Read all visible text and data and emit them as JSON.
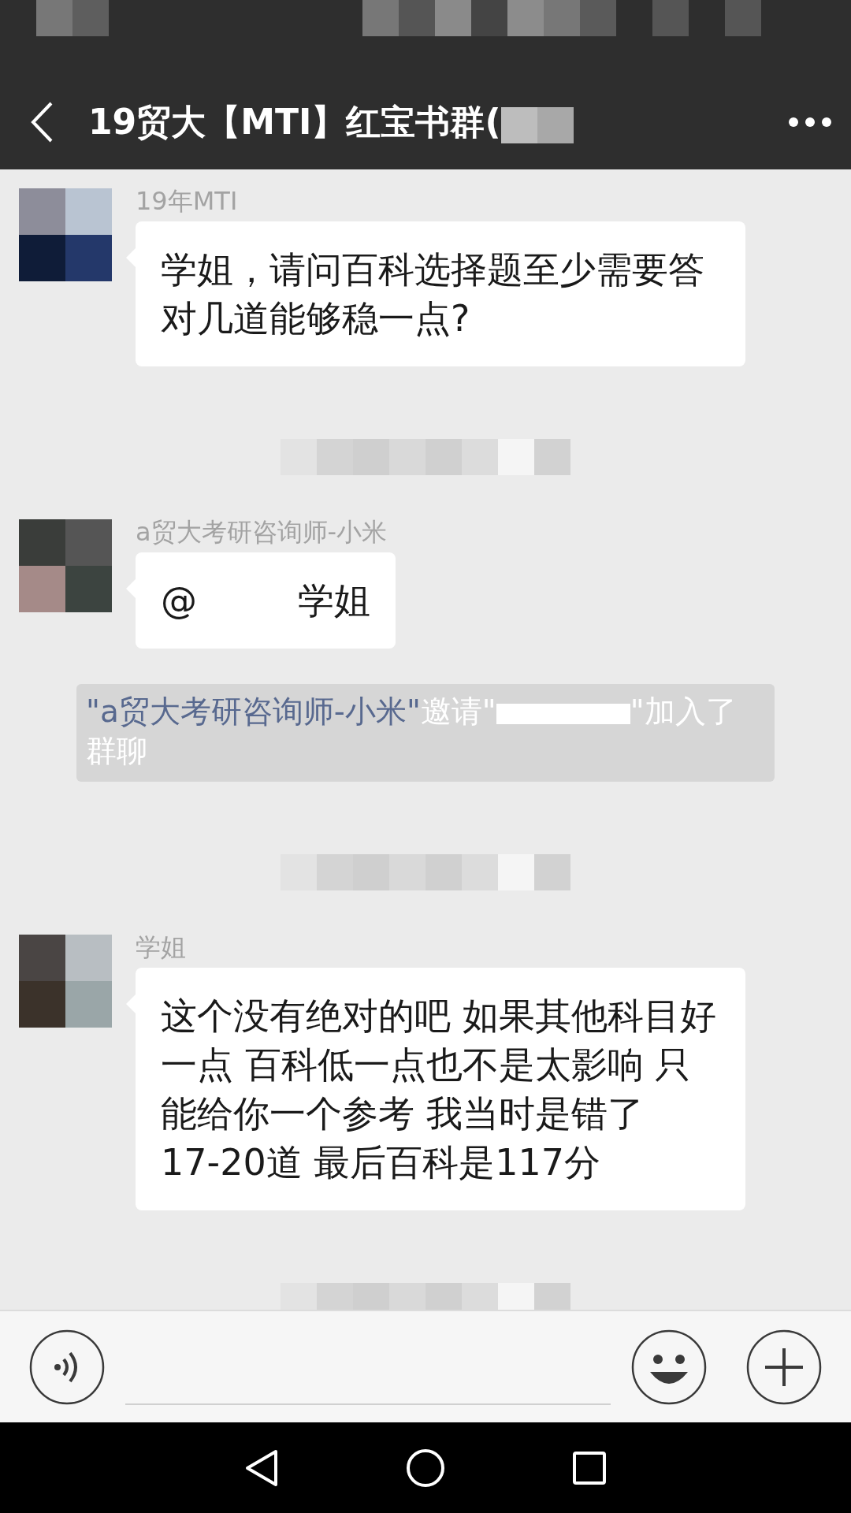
{
  "header": {
    "title": "19贸大【MTI】红宝书群("
  },
  "messages": [
    {
      "kind": "message",
      "sender": "19年MTI",
      "text": "学姐，请问百科选择题至少需要答对几道能够稳一点?"
    },
    {
      "kind": "timestamp"
    },
    {
      "kind": "mention",
      "sender": "a贸大考研咨询师-小米",
      "mention": "@",
      "text": "学姐"
    },
    {
      "kind": "system",
      "inviter": "\"a贸大考研咨询师-小米\"",
      "before_redaction": "邀请\"",
      "after_redaction": "\"加入了群聊"
    },
    {
      "kind": "timestamp"
    },
    {
      "kind": "message",
      "sender": "学姐",
      "text": "这个没有绝对的吧 如果其他科目好一点 百科低一点也不是太影响 只能给你一个参考 我当时是错了17-20道 最后百科是117分"
    },
    {
      "kind": "timestamp"
    }
  ]
}
